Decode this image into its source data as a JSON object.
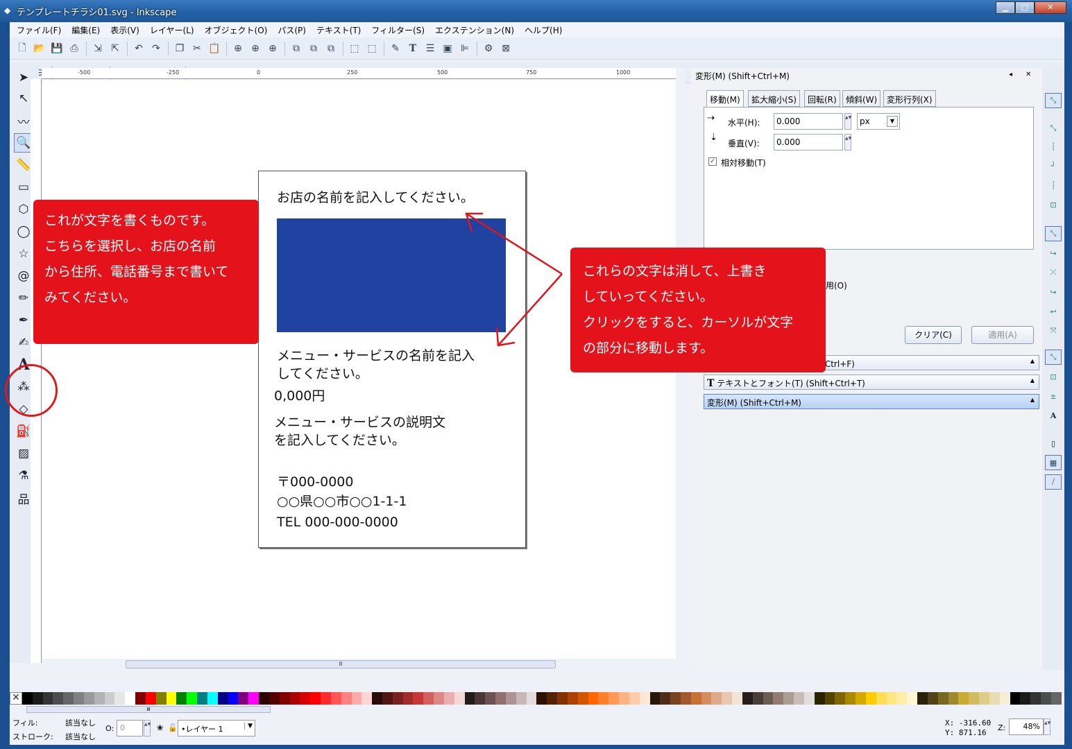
{
  "window": {
    "title": "テンプレートチラシ01.svg - Inkscape",
    "controls": {
      "minimize": "▁",
      "maximize": "□",
      "close": "✕"
    }
  },
  "menu": [
    "ファイル(F)",
    "編集(E)",
    "表示(V)",
    "レイヤー(L)",
    "オブジェクト(O)",
    "パス(P)",
    "テキスト(T)",
    "フィルター(S)",
    "エクステンション(N)",
    "ヘルプ(H)"
  ],
  "ruler": {
    "marks": [
      "-500",
      "-250",
      "0",
      "250",
      "500",
      "750",
      "1000"
    ]
  },
  "page": {
    "shop_name": "お店の名前を記入してください。",
    "menu_name_1": "メニュー・サービスの名前を記入",
    "menu_name_2": "してください。",
    "price": "0,000円",
    "desc_1": "メニュー・サービスの説明文",
    "desc_2": "を記入してください。",
    "postal": "〒000-0000",
    "address": "○○県○○市○○1-1-1",
    "tel": "TEL 000-000-0000",
    "box_color": "#2042a0"
  },
  "callouts": {
    "left": [
      "これが文字を書くものです。",
      "こちらを選択し、お店の名前",
      "から住所、電話番号まで書いて",
      "みてください。"
    ],
    "right": [
      "これらの文字は消して、上書き",
      "していってください。",
      "クリックをすると、カーソルが文字",
      "の部分に移動します。"
    ],
    "color": "#e4131b"
  },
  "dock": {
    "title": "変形(M) (Shift+Ctrl+M)",
    "tabs": [
      "移動(M)",
      "拡大縮小(S)",
      "回転(R)",
      "傾斜(W)",
      "変形行列(X)"
    ],
    "horizontal_label": "水平(H):",
    "horizontal_value": "0.000",
    "vertical_label": "垂直(V):",
    "vertical_value": "0.000",
    "unit": "px",
    "relative_move": "相対移動(T)",
    "apply_separately_partial": "用(O)",
    "clear_button": "クリア(C)",
    "apply_button": "適用(A)",
    "panels": [
      "フィルとストローク(F) (Shift+Ctrl+F)",
      "テキストとフォント(T) (Shift+Ctrl+T)",
      "変形(M) (Shift+Ctrl+M)"
    ]
  },
  "status": {
    "fill_label": "フィル:",
    "fill_value": "該当なし",
    "stroke_label": "ストローク:",
    "stroke_value": "該当なし",
    "opacity_label": "O:",
    "opacity_value": "0",
    "layer": "•レイヤー 1",
    "x_coord": "X: -316.60",
    "y_coord": "Y:  871.16",
    "zoom_label": "Z:",
    "zoom_value": "48%"
  },
  "palette": [
    "#000000",
    "#1a1a1a",
    "#333333",
    "#4d4d4d",
    "#666666",
    "#808080",
    "#999999",
    "#b3b3b3",
    "#cccccc",
    "#e6e6e6",
    "#ffffff",
    "#800000",
    "#ff0000",
    "#808000",
    "#ffff00",
    "#008000",
    "#00ff00",
    "#008080",
    "#00ffff",
    "#000080",
    "#0000ff",
    "#800080",
    "#ff00ff",
    "#2b0000",
    "#550000",
    "#800000",
    "#aa0000",
    "#d40000",
    "#ff0000",
    "#ff2a2a",
    "#ff5555",
    "#ff8080",
    "#ffaaaa",
    "#ffd5d5",
    "#280b0b",
    "#501616",
    "#782121",
    "#a02c2c",
    "#c83737",
    "#d35f5f",
    "#de8787",
    "#e9afaf",
    "#f4d7d7",
    "#241c1c",
    "#483737",
    "#6c5353",
    "#916f6f",
    "#ac9393",
    "#c8b7b7",
    "#e3dbdb",
    "#2b1100",
    "#552200",
    "#803300",
    "#aa4400",
    "#d45500",
    "#ff6600",
    "#ff7f2a",
    "#ff9955",
    "#ffb380",
    "#ffccaa",
    "#ffe6d5",
    "#28170b",
    "#502d16",
    "#784421",
    "#a05a2c",
    "#c87137",
    "#d38d5f",
    "#deaa87",
    "#e9c6af",
    "#f4e3d7",
    "#241f1c",
    "#483e37",
    "#6c5d53",
    "#917c6f",
    "#ac9d93",
    "#c8beb7",
    "#e3dedb",
    "#2b2200",
    "#554400",
    "#806600",
    "#aa8800",
    "#d4aa00",
    "#ffcc00",
    "#ffdd55",
    "#ffe680",
    "#ffeeaa",
    "#fff6d5",
    "#28220b",
    "#504416",
    "#786721",
    "#a0892c",
    "#c8ab37",
    "#d3bc5f",
    "#decd87",
    "#e9ddaf",
    "#f4eed7",
    "#000000",
    "#1a1a1a",
    "#333333",
    "#4d4d4d",
    "#666666"
  ]
}
